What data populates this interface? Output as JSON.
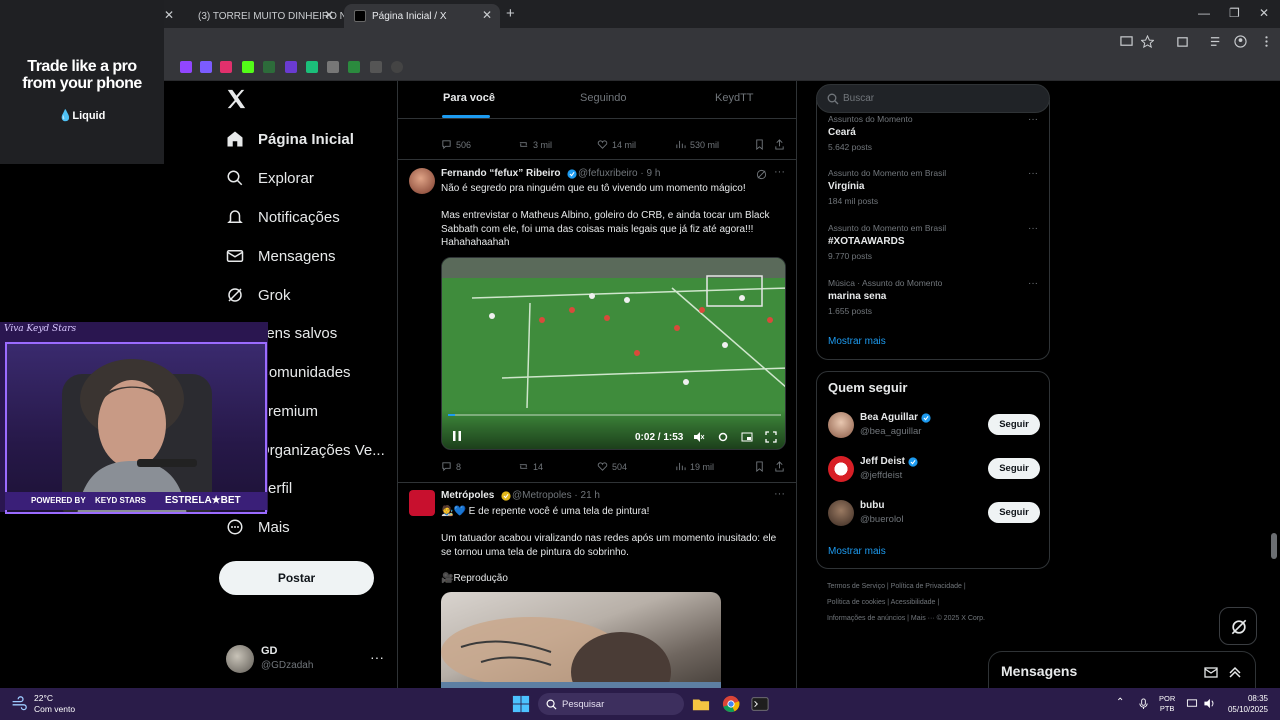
{
  "browser": {
    "tabs": [
      {
        "label": "",
        "active": false
      },
      {
        "label": "(3) TORREI MUITO DINHEIRO N",
        "active": false
      },
      {
        "label": "Página Inicial / X",
        "active": true
      }
    ]
  },
  "ad": {
    "headline_line1": "Trade like a pro",
    "headline_line2": "from your phone",
    "brand": "Liquid"
  },
  "nav": {
    "items": [
      {
        "label": "Página Inicial",
        "icon": "home-icon"
      },
      {
        "label": "Explorar",
        "icon": "search-icon"
      },
      {
        "label": "Notificações",
        "icon": "bell-icon"
      },
      {
        "label": "Mensagens",
        "icon": "mail-icon"
      },
      {
        "label": "Grok",
        "icon": "grok-icon"
      },
      {
        "label": "Itens salvos",
        "icon": "bookmark-icon"
      },
      {
        "label": "Comunidades",
        "icon": "people-icon"
      },
      {
        "label": "Premium",
        "icon": "x-icon"
      },
      {
        "label": "Organizações Ve...",
        "icon": "lightning-icon"
      },
      {
        "label": "Perfil",
        "icon": "user-icon"
      },
      {
        "label": "Mais",
        "icon": "more-circle-icon"
      }
    ],
    "post_label": "Postar",
    "account": {
      "name": "GD",
      "handle": "@GDzadah"
    }
  },
  "webcam": {
    "title": "Viva Keyd Stars",
    "powered_by": "POWERED BY",
    "keyd": "KEYD STARS",
    "sponsor": "ESTRELA★BET"
  },
  "feed": {
    "tabs": [
      "Para você",
      "Seguindo",
      "KeydTT"
    ],
    "top_actions": {
      "replies": "506",
      "reposts": "3 mil",
      "likes": "14 mil",
      "views": "530 mil"
    },
    "tweets": [
      {
        "name": "Fernando “fefux” Ribeiro",
        "handle": "@fefuxribeiro",
        "time": "· 9 h",
        "line1": "Não é segredo pra ninguém que eu tô vivendo um momento mágico!",
        "line2": "Mas entrevistar o Matheus Albino, goleiro do CRB, e ainda tocar um Black Sabbath com ele, foi uma das coisas mais legais que já fiz até agora!!!",
        "line3": "Hahahahaahah",
        "video_time": "0:02 / 1:53",
        "video_progress": 0.02,
        "replies": "8",
        "reposts": "14",
        "likes": "504",
        "views": "19 mil"
      },
      {
        "name": "Metrópoles",
        "handle": "@Metropoles",
        "time": "· 21 h",
        "line1": "🧑‍🎨💙 E de repente você é uma tela de pintura!",
        "line2": "Um tatuador acabou viralizando nas redes após um momento inusitado: ele se tornou uma tela de pintura do sobrinho.",
        "line3": "🎥Reprodução"
      }
    ]
  },
  "sidebar": {
    "search_placeholder": "Buscar",
    "trends": [
      {
        "category": "Assuntos do Momento",
        "title": "Ceará",
        "count": "5.642 posts"
      },
      {
        "category": "Assunto do Momento em Brasil",
        "title": "Virgínia",
        "count": "184 mil posts"
      },
      {
        "category": "Assunto do Momento em Brasil",
        "title": "#XOTAAWARDS",
        "count": "9.770 posts"
      },
      {
        "category": "Música · Assunto do Momento",
        "title": "marina sena",
        "count": "1.655 posts"
      }
    ],
    "trends_more": "Mostrar mais",
    "who_title": "Quem seguir",
    "who": [
      {
        "name": "Bea Aguillar",
        "handle": "@bea_aguillar",
        "follow": "Seguir"
      },
      {
        "name": "Jeff Deist",
        "handle": "@jeffdeist",
        "follow": "Seguir"
      },
      {
        "name": "bubu",
        "handle": "@buerolol",
        "follow": "Seguir"
      }
    ],
    "who_more": "Mostrar mais",
    "footer_line1": "Termos de Serviço  |  Política de Privacidade  |",
    "footer_line2": "Política de cookies  |  Acessibilidade  |",
    "footer_line3": "Informações de anúncios  |  Mais ···  © 2025 X Corp."
  },
  "messages_drawer": "Mensagens",
  "taskbar": {
    "temp": "22°C",
    "weather": "Com vento",
    "search": "Pesquisar",
    "lang1": "POR",
    "lang2": "PTB",
    "time": "08:35",
    "date": "05/10/2025"
  },
  "colors": {
    "accent": "#1d9bf0",
    "taskbar": "#2a1c49",
    "border": "#2f3336"
  }
}
